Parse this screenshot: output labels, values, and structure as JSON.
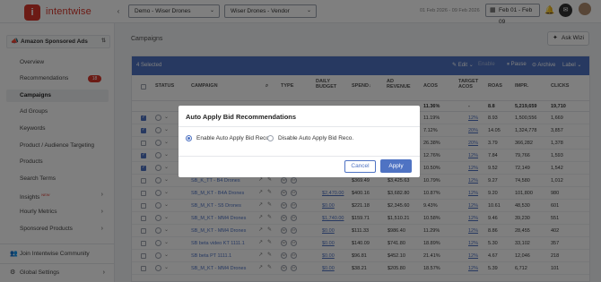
{
  "header": {
    "logo_mark": "i",
    "brand": "intentwise",
    "account_select": "Demo - Wiser Drones",
    "profile_select": "Wiser Drones - Vendor",
    "date_range_text": "01 Feb 2026 - 09 Feb 2026",
    "date_picker": "Feb 01 - Feb 09"
  },
  "sidebar": {
    "account_label": "Amazon Sponsored Ads",
    "items": [
      {
        "label": "Overview"
      },
      {
        "label": "Recommendations",
        "badge": "18"
      },
      {
        "label": "Campaigns"
      },
      {
        "label": "Ad Groups"
      },
      {
        "label": "Keywords"
      },
      {
        "label": "Product / Audience Targeting"
      },
      {
        "label": "Products"
      },
      {
        "label": "Search Terms"
      },
      {
        "label": "Insights",
        "tag": "NEW"
      },
      {
        "label": "Hourly Metrics"
      },
      {
        "label": "Sponsored Products"
      }
    ],
    "community": "Join Intentwise Community",
    "global_settings": "Global Settings"
  },
  "main": {
    "breadcrumb": "Campaigns",
    "ask_wizi": "Ask Wizi",
    "selection": {
      "count": "4 Selected",
      "edit": "Edit",
      "pause": "Pause",
      "archive": "Archive",
      "label": "Label",
      "dim_action": "Enable"
    },
    "columns": [
      "STATUS",
      "CAMPAIGN",
      "TYPE",
      "DAILY BUDGET",
      "SPEND",
      "AD REVENUE",
      "ACOS",
      "TARGET ACOS",
      "ROAS",
      "IMPR.",
      "CLICKS"
    ],
    "totals": {
      "acos": "11.36%",
      "target_acos": "-",
      "roas": "8.8",
      "impr": "5,219,659",
      "clicks": "19,710"
    },
    "rows": [
      {
        "checked": true,
        "acos": "11.19%",
        "tacos": "12%",
        "roas": "8.93",
        "impr": "1,500,556",
        "clicks": "1,669"
      },
      {
        "checked": true,
        "acos": "7.12%",
        "tacos": "20%",
        "roas": "14.05",
        "impr": "1,324,778",
        "clicks": "3,857"
      },
      {
        "checked": false,
        "acos": "26.38%",
        "tacos": "20%",
        "roas": "3.79",
        "impr": "366,282",
        "clicks": "1,378"
      },
      {
        "checked": true,
        "acos": "12.76%",
        "tacos": "12%",
        "roas": "7.84",
        "impr": "79,766",
        "clicks": "1,593"
      },
      {
        "checked": true,
        "acos": "10.50%",
        "tacos": "12%",
        "roas": "9.52",
        "impr": "72,149",
        "clicks": "1,542"
      },
      {
        "checked": false,
        "campaign": "SB_K_TT - B4 Drones",
        "budget": "",
        "spend": "$369.49",
        "revenue": "$3,425.63",
        "acos": "10.79%",
        "tacos": "12%",
        "roas": "9.27",
        "impr": "74,580",
        "clicks": "1,012"
      },
      {
        "checked": false,
        "campaign": "SB_M_KT - B4A Drones",
        "budget": "$2,470.00",
        "spend": "$400.16",
        "revenue": "$3,682.80",
        "acos": "10.87%",
        "tacos": "12%",
        "roas": "9.20",
        "impr": "101,800",
        "clicks": "980"
      },
      {
        "checked": false,
        "campaign": "SB_M_KT - S5 Drones",
        "budget": "$0.00",
        "spend": "$221.18",
        "revenue": "$2,345.60",
        "acos": "9.43%",
        "tacos": "12%",
        "roas": "10.61",
        "impr": "48,530",
        "clicks": "601"
      },
      {
        "checked": false,
        "campaign": "SB_M_KT - MM4 Drones",
        "budget": "$1,740.00",
        "spend": "$159.71",
        "revenue": "$1,510.21",
        "acos": "10.58%",
        "tacos": "12%",
        "roas": "9.46",
        "impr": "39,230",
        "clicks": "551"
      },
      {
        "checked": false,
        "campaign": "SB_M_KT - MM4 Drones",
        "budget": "$0.00",
        "spend": "$111.33",
        "revenue": "$986.40",
        "acos": "11.29%",
        "tacos": "12%",
        "roas": "8.86",
        "impr": "28,455",
        "clicks": "402"
      },
      {
        "checked": false,
        "campaign": "SB beta video KT 1111.1",
        "budget": "$0.00",
        "spend": "$140.09",
        "revenue": "$741.80",
        "acos": "18.89%",
        "tacos": "12%",
        "roas": "5.30",
        "impr": "33,102",
        "clicks": "357"
      },
      {
        "checked": false,
        "campaign": "SB beta PT 1111.1",
        "budget": "$0.00",
        "spend": "$96.81",
        "revenue": "$452.10",
        "acos": "21.41%",
        "tacos": "12%",
        "roas": "4.67",
        "impr": "12,046",
        "clicks": "218"
      },
      {
        "checked": false,
        "campaign": "SB_M_KT - MM4 Drones",
        "budget": "$0.00",
        "spend": "$38.21",
        "revenue": "$205.80",
        "acos": "18.57%",
        "tacos": "12%",
        "roas": "5.39",
        "impr": "6,712",
        "clicks": "101"
      }
    ]
  },
  "modal": {
    "title": "Auto Apply Bid Recommendations",
    "option_enable": "Enable Auto Apply Bid Reco.",
    "option_disable": "Disable Auto Apply Bid Reco.",
    "selected": "enable",
    "cancel": "Cancel",
    "apply": "Apply"
  },
  "colors": {
    "brand": "#d9362b",
    "accent": "#4f73c3",
    "overlay": "rgba(0,0,0,0.5)"
  }
}
